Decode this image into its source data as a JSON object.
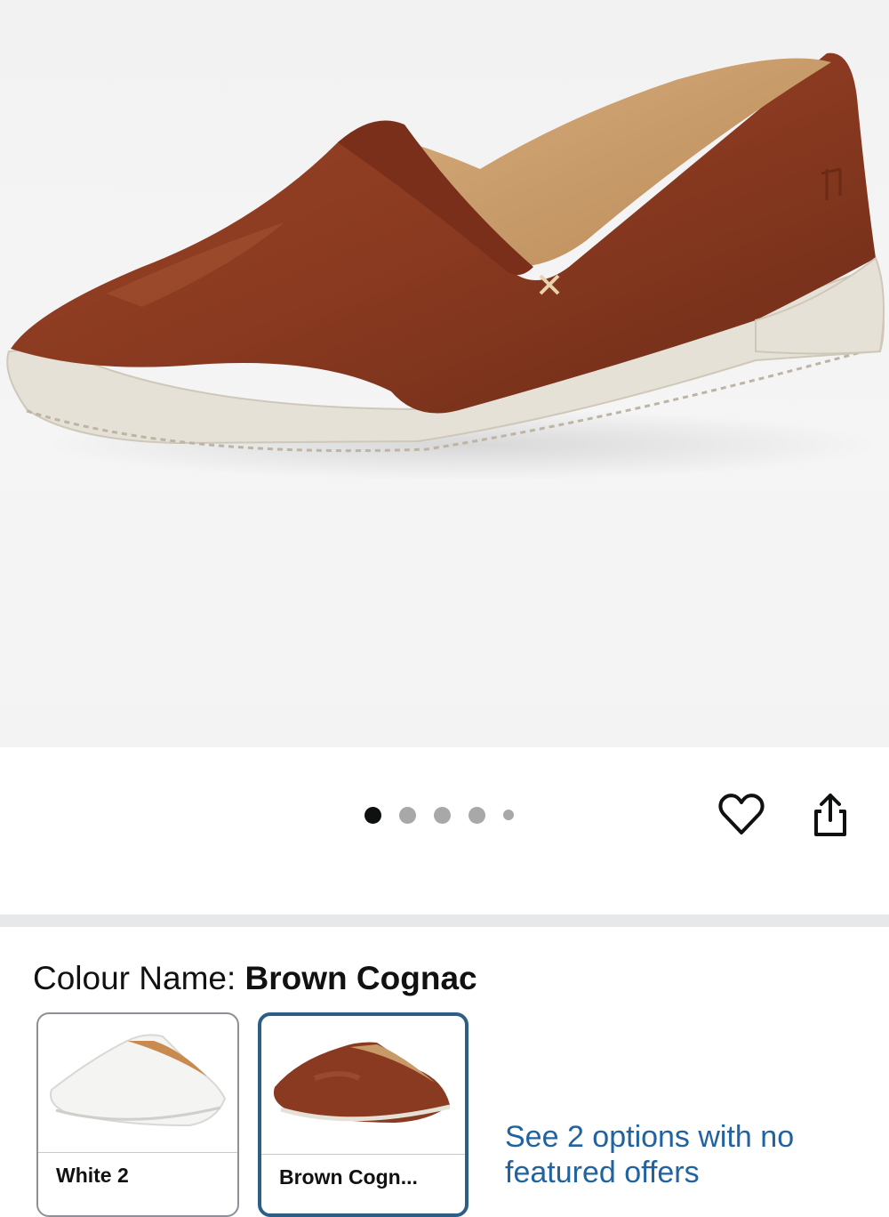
{
  "product_image": {
    "alt": "Brown Cognac leather slip-on shoe",
    "carousel": {
      "count": 5,
      "active_index": 0
    }
  },
  "actions": {
    "wishlist_icon": "heart-outline-icon",
    "share_icon": "share-icon"
  },
  "colour": {
    "label": "Colour Name:",
    "selected": "Brown Cognac"
  },
  "swatches": [
    {
      "name": "White 2",
      "selected": false,
      "color": "#ffffff"
    },
    {
      "name": "Brown Cogn...",
      "selected": true,
      "color": "#8b3a22"
    }
  ],
  "see_options_link": "See 2 options with no featured offers",
  "colors": {
    "selected_border": "#2c5e86",
    "link": "#2162a1",
    "shoe_leather": "#8b3a22",
    "sole": "#e6e1d6"
  }
}
